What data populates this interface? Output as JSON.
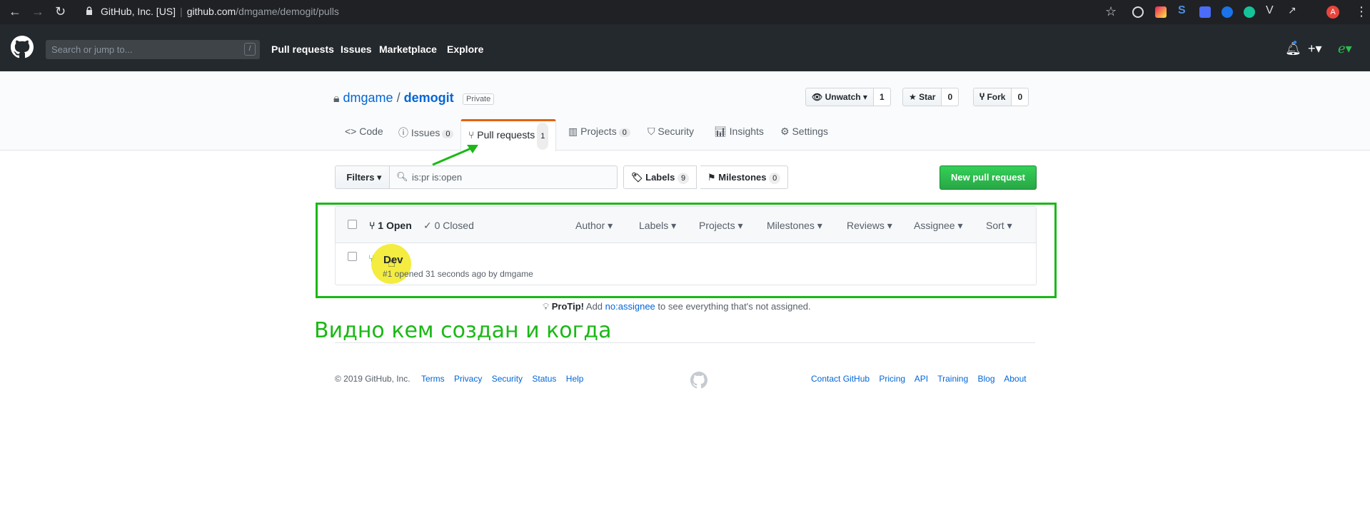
{
  "browser": {
    "site_identity": "GitHub, Inc. [US]",
    "url_host": "github.com",
    "url_path": "/dmgame/demogit/pulls",
    "profile_initial": "A"
  },
  "header": {
    "search_placeholder": "Search or jump to...",
    "search_shortcut": "/",
    "nav": [
      "Pull requests",
      "Issues",
      "Marketplace",
      "Explore"
    ]
  },
  "repo": {
    "owner": "dmgame",
    "name": "demogit",
    "visibility": "Private",
    "unwatch_label": "Unwatch ▾",
    "watch_count": "1",
    "star_label": "Star",
    "star_count": "0",
    "fork_label": "Fork",
    "fork_count": "0"
  },
  "tabs": {
    "code": "Code",
    "issues": "Issues",
    "issues_count": "0",
    "pulls": "Pull requests",
    "pulls_count": "1",
    "projects": "Projects",
    "projects_count": "0",
    "security": "Security",
    "insights": "Insights",
    "settings": "Settings"
  },
  "filters": {
    "filters_label": "Filters ▾",
    "query": "is:pr is:open",
    "labels_label": "Labels",
    "labels_count": "9",
    "milestones_label": "Milestones",
    "milestones_count": "0",
    "new_pr_label": "New pull request"
  },
  "list": {
    "open_label": "1 Open",
    "closed_label": "✓ 0 Closed",
    "author": "Author ▾",
    "labels": "Labels ▾",
    "projects": "Projects ▾",
    "milestones": "Milestones ▾",
    "reviews": "Reviews ▾",
    "assignee": "Assignee ▾",
    "sort": "Sort ▾",
    "pr_title": "Dev",
    "pr_meta": "#1 opened 31 seconds ago by dmgame"
  },
  "protip": {
    "lead": "ProTip!",
    "pre": "Add",
    "link": "no:assignee",
    "post": "to see everything that's not assigned."
  },
  "annotation": {
    "text": "Видно кем создан и когда",
    "color": "#1bb817"
  },
  "footer": {
    "copyright": "© 2019 GitHub, Inc.",
    "left_links": [
      "Terms",
      "Privacy",
      "Security",
      "Status",
      "Help"
    ],
    "right_links": [
      "Contact GitHub",
      "Pricing",
      "API",
      "Training",
      "Blog",
      "About"
    ]
  }
}
